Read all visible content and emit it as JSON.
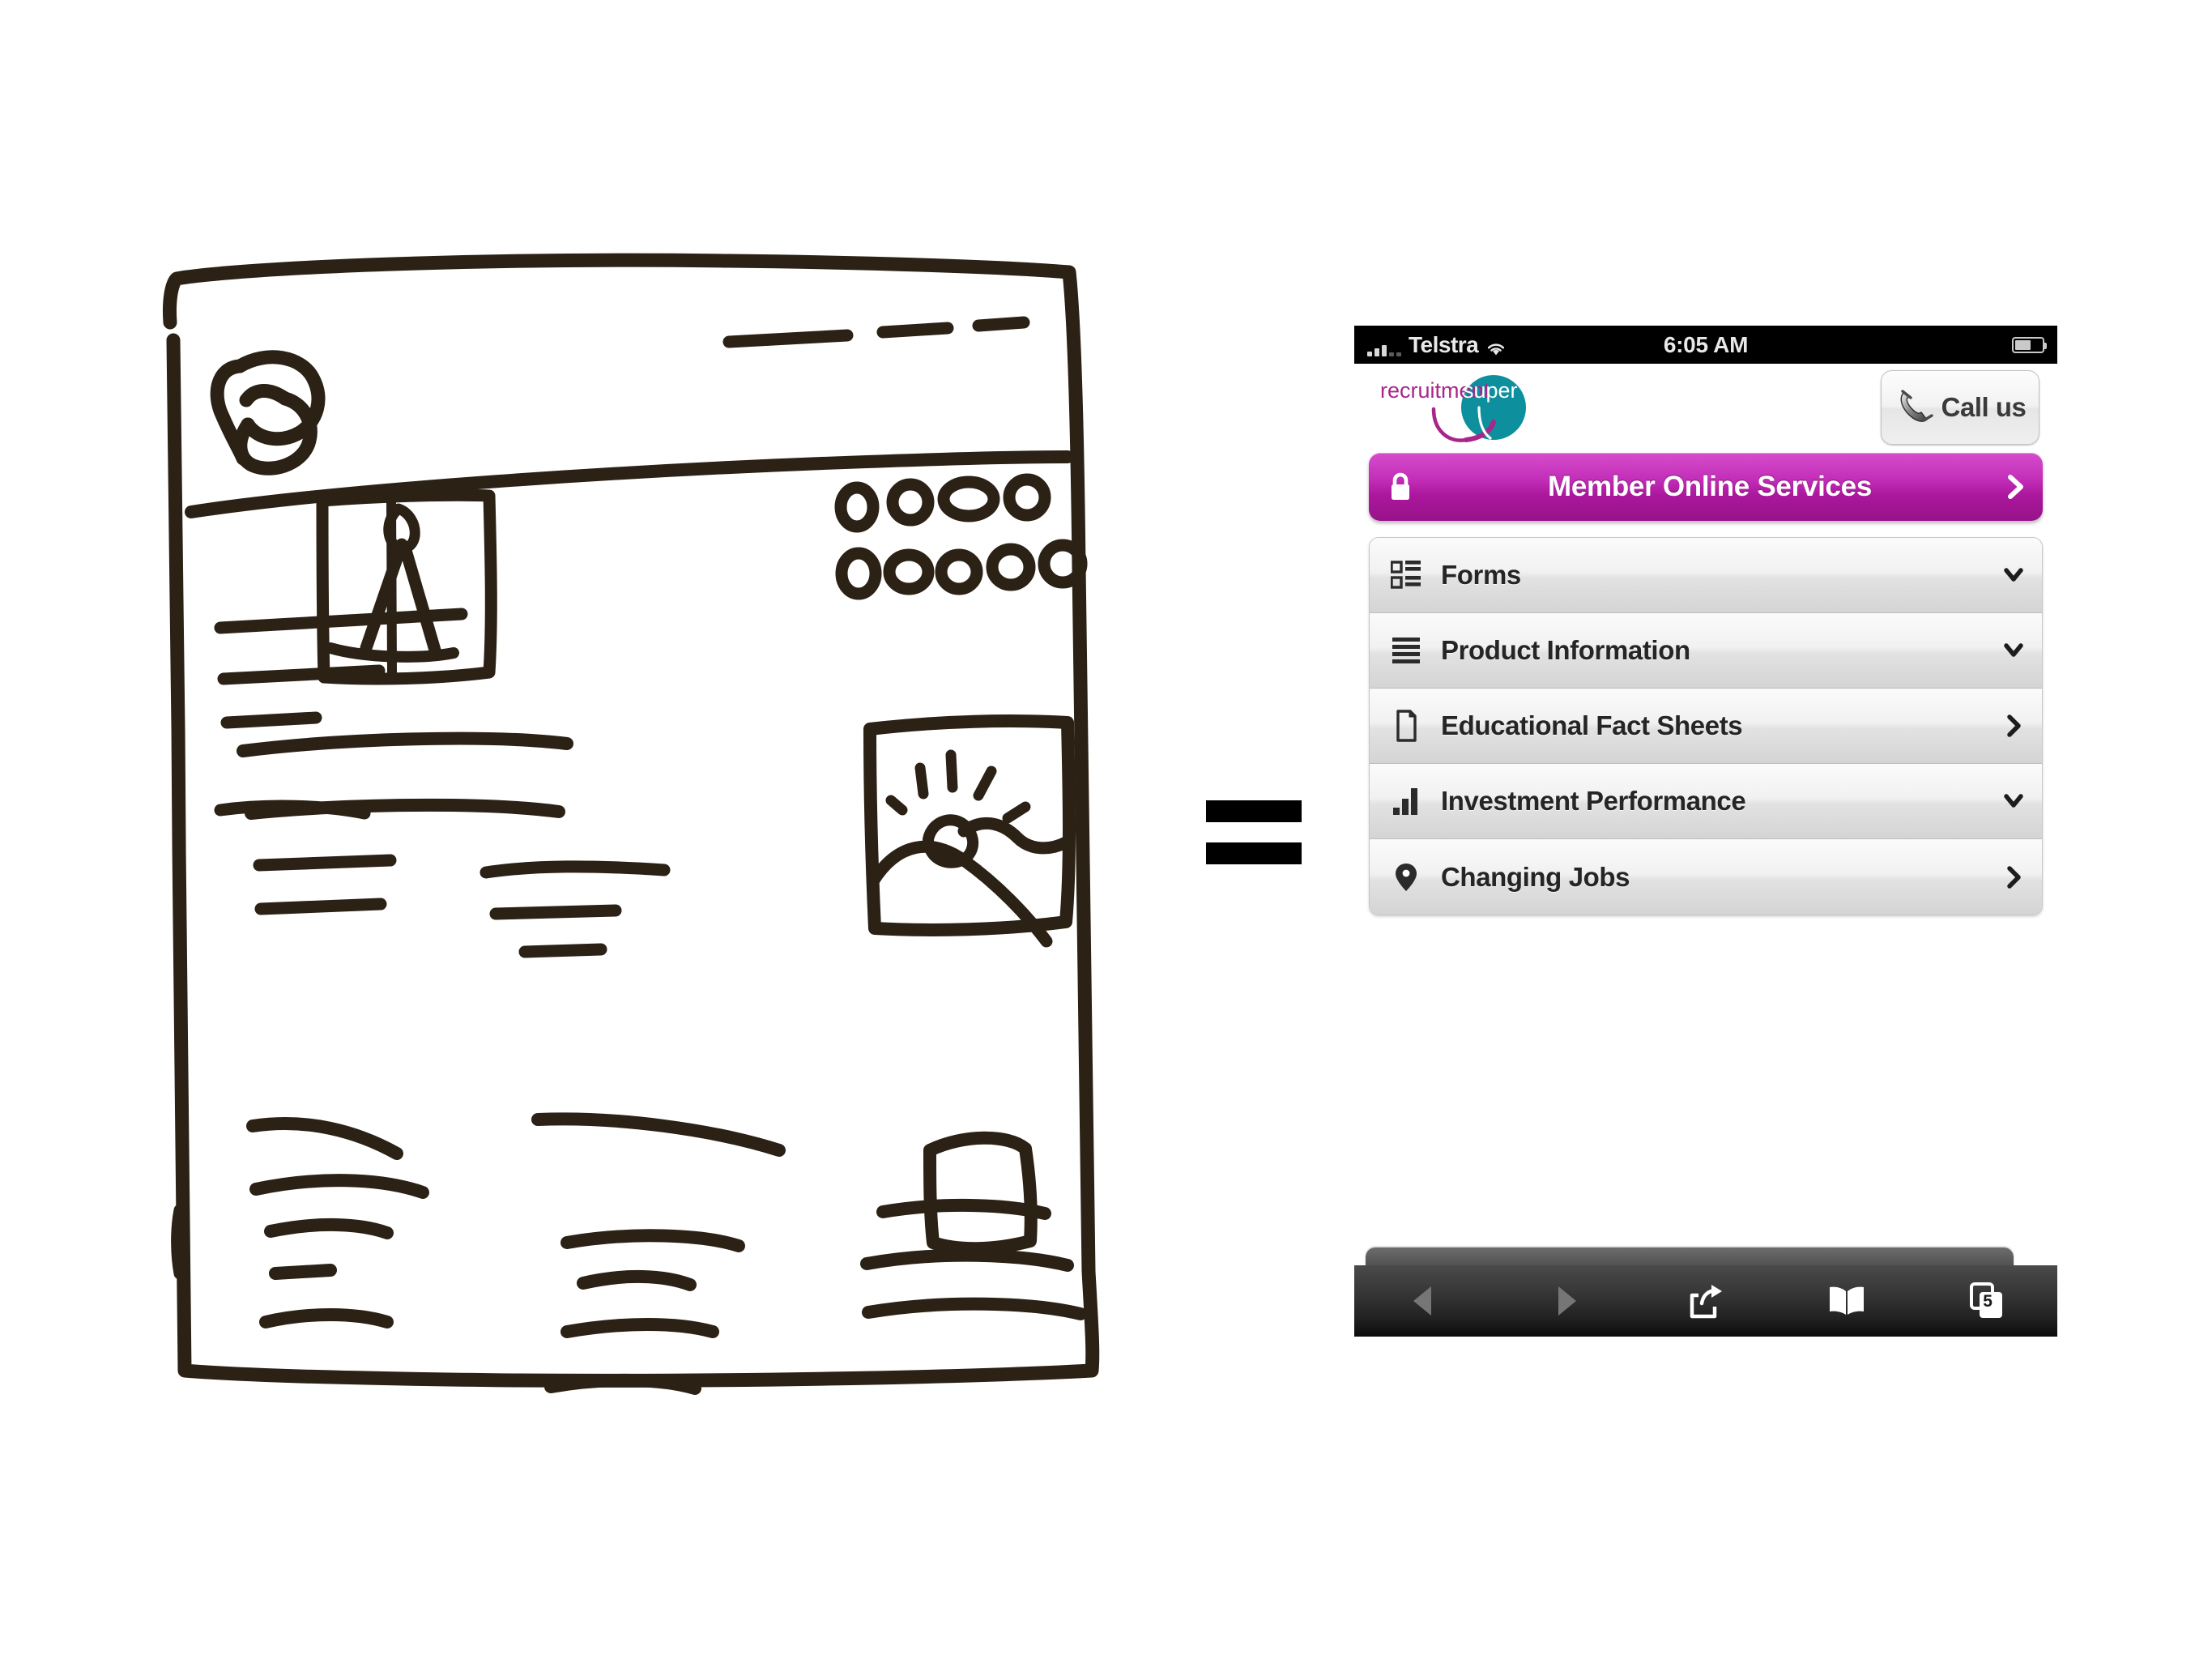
{
  "comparison": {
    "equals_symbol": "="
  },
  "sketch": {
    "caption": "hand-drawn website wireframe sketch",
    "elements": [
      "logo-scribble",
      "nav-dashes",
      "header-rule",
      "text-lines",
      "image-placeholder-person",
      "dot-grid",
      "image-placeholder-landscape",
      "image-placeholder-small",
      "paragraph-columns"
    ]
  },
  "phone": {
    "status_bar": {
      "carrier": "Telstra",
      "time": "6:05 AM",
      "signal_icon": "signal-bars-icon",
      "wifi_icon": "wifi-icon",
      "battery_icon": "battery-icon",
      "battery_level_percent": 54
    },
    "header": {
      "logo": {
        "icon": "recruitmentsuper-logo",
        "text_primary": "recruitment",
        "text_secondary": "super",
        "color_primary": "#a8268c",
        "color_secondary": "#0e8f9e"
      },
      "call_us": {
        "label": "Call us",
        "icon": "phone-handset-icon"
      }
    },
    "primary_button": {
      "label": "Member Online Services",
      "lead_icon": "lock-icon",
      "trail_icon": "chevron-right-icon",
      "color_start": "#d64ccd",
      "color_end": "#97138a"
    },
    "menu": [
      {
        "label": "Forms",
        "icon": "forms-list-icon",
        "chevron": "chevron-down-icon"
      },
      {
        "label": "Product Information",
        "icon": "lines-menu-icon",
        "chevron": "chevron-down-icon"
      },
      {
        "label": "Educational Fact Sheets",
        "icon": "document-icon",
        "chevron": "chevron-right-icon"
      },
      {
        "label": "Investment Performance",
        "icon": "bar-chart-icon",
        "chevron": "chevron-down-icon"
      },
      {
        "label": "Changing Jobs",
        "icon": "location-pin-icon",
        "chevron": "chevron-right-icon"
      }
    ],
    "toolbar": {
      "back": {
        "icon": "back-arrow-icon",
        "enabled": false
      },
      "forward": {
        "icon": "forward-arrow-icon",
        "enabled": false
      },
      "share": {
        "icon": "share-icon"
      },
      "bookmarks": {
        "icon": "book-icon"
      },
      "tabs": {
        "icon": "tabs-icon",
        "count": "5"
      }
    }
  }
}
